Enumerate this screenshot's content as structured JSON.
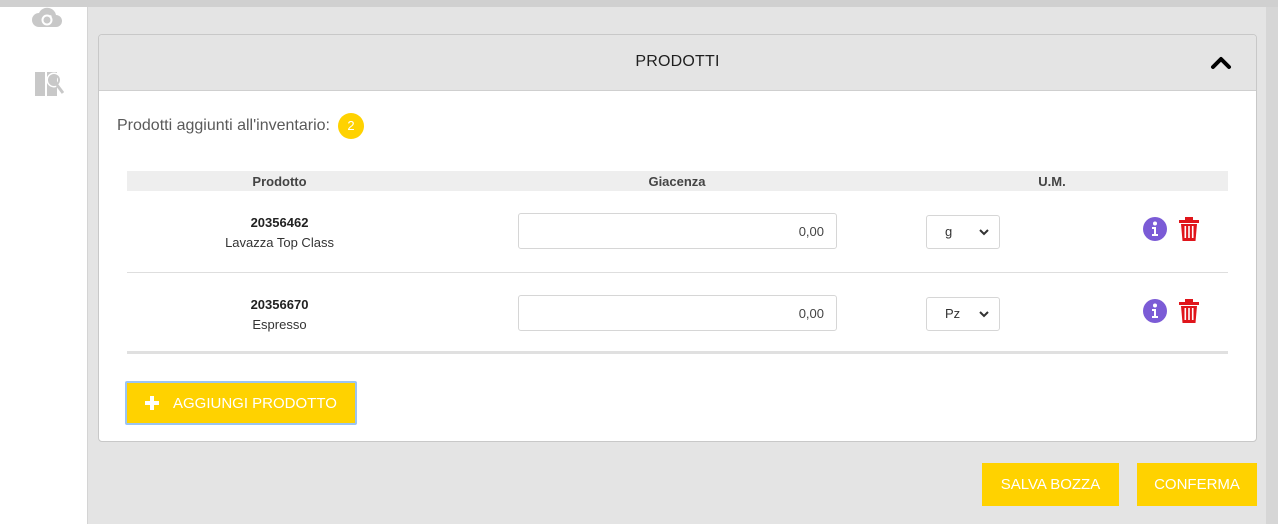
{
  "sidebar": {
    "icons": [
      "cloud-sync-icon",
      "keys-icon"
    ]
  },
  "panel": {
    "title": "PRODOTTI",
    "collapse_icon": "chevron-up-icon",
    "count_label": "Prodotti aggiunti all'inventario:",
    "count": "2"
  },
  "table": {
    "headers": {
      "product": "Prodotto",
      "stock": "Giacenza",
      "unit": "U.M."
    },
    "rows": [
      {
        "code": "20356462",
        "name": "Lavazza Top Class",
        "stock": "0,00",
        "unit": "g"
      },
      {
        "code": "20356670",
        "name": "Espresso",
        "stock": "0,00",
        "unit": "Pz"
      }
    ]
  },
  "buttons": {
    "add_product": "AGGIUNGI PRODOTTO",
    "save_draft": "SALVA BOZZA",
    "confirm": "CONFERMA"
  },
  "colors": {
    "accent": "#ffd200",
    "info": "#7b5bd6",
    "danger": "#e0151b",
    "add_button_border": "#9bc4f2"
  }
}
